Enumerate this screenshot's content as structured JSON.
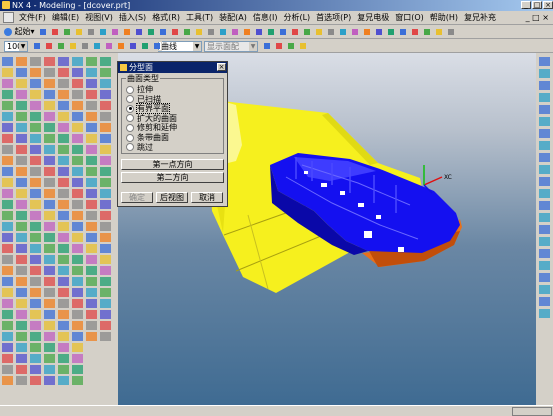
{
  "window": {
    "title": "NX 4 - Modeling - [dcover.prt]"
  },
  "menu": {
    "items": [
      "文件(F)",
      "编辑(E)",
      "视图(V)",
      "插入(S)",
      "格式(R)",
      "工具(T)",
      "装配(A)",
      "信息(I)",
      "分析(L)",
      "首选项(P)",
      "复兄电极",
      "窗口(O)",
      "帮助(H)",
      "复兄补充"
    ]
  },
  "toolbar": {
    "start_label": "起始",
    "zoom_value": "100",
    "curve_combo": "曲线",
    "display_combo": "显示面配"
  },
  "dialog": {
    "title": "分型面",
    "group_label": "曲面类型",
    "options": [
      {
        "label": "拉伸",
        "selected": false
      },
      {
        "label": "已扫描",
        "selected": false
      },
      {
        "label": "有界平面",
        "selected": true
      },
      {
        "label": "扩大的曲面",
        "selected": false
      },
      {
        "label": "修剪和延伸",
        "selected": false
      },
      {
        "label": "条带曲面",
        "selected": false
      },
      {
        "label": "跳过",
        "selected": false
      }
    ],
    "dir1_label": "第一点方向",
    "dir2_label": "第二方向",
    "ok_label": "确定",
    "back_label": "后视图",
    "cancel_label": "取消"
  },
  "viewport": {
    "axis_label": "XC",
    "colors": {
      "parting_surface": "#f6f01e",
      "part_body": "#1410f0",
      "electrode": "#e8701a",
      "axis_x": "#e01010",
      "axis_y": "#10c010",
      "axis_z": "#1010e0"
    }
  }
}
